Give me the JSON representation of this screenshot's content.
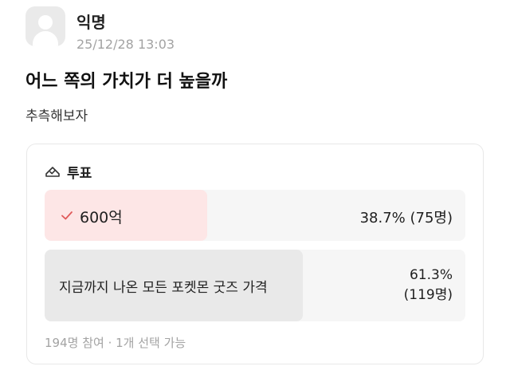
{
  "author": {
    "name": "익명",
    "time": "25/12/28 13:03"
  },
  "post": {
    "title": "어느 쪽의 가치가 더 높을까",
    "body": "추측해보자"
  },
  "poll": {
    "icon": "ballot-box-icon",
    "label": "투표",
    "accent_color": "#e05a5a",
    "options": [
      {
        "label": "600억",
        "result": "38.7% (75명)",
        "percent": 38.7,
        "votes": 75,
        "selected": true
      },
      {
        "label": "지금까지 나온 모든 포켓몬 굿즈 가격",
        "percent_text": "61.3%",
        "votes_text": "(119명)",
        "percent": 61.3,
        "votes": 119,
        "selected": false
      }
    ],
    "footer": "194명 참여 · 1개 선택 가능"
  }
}
